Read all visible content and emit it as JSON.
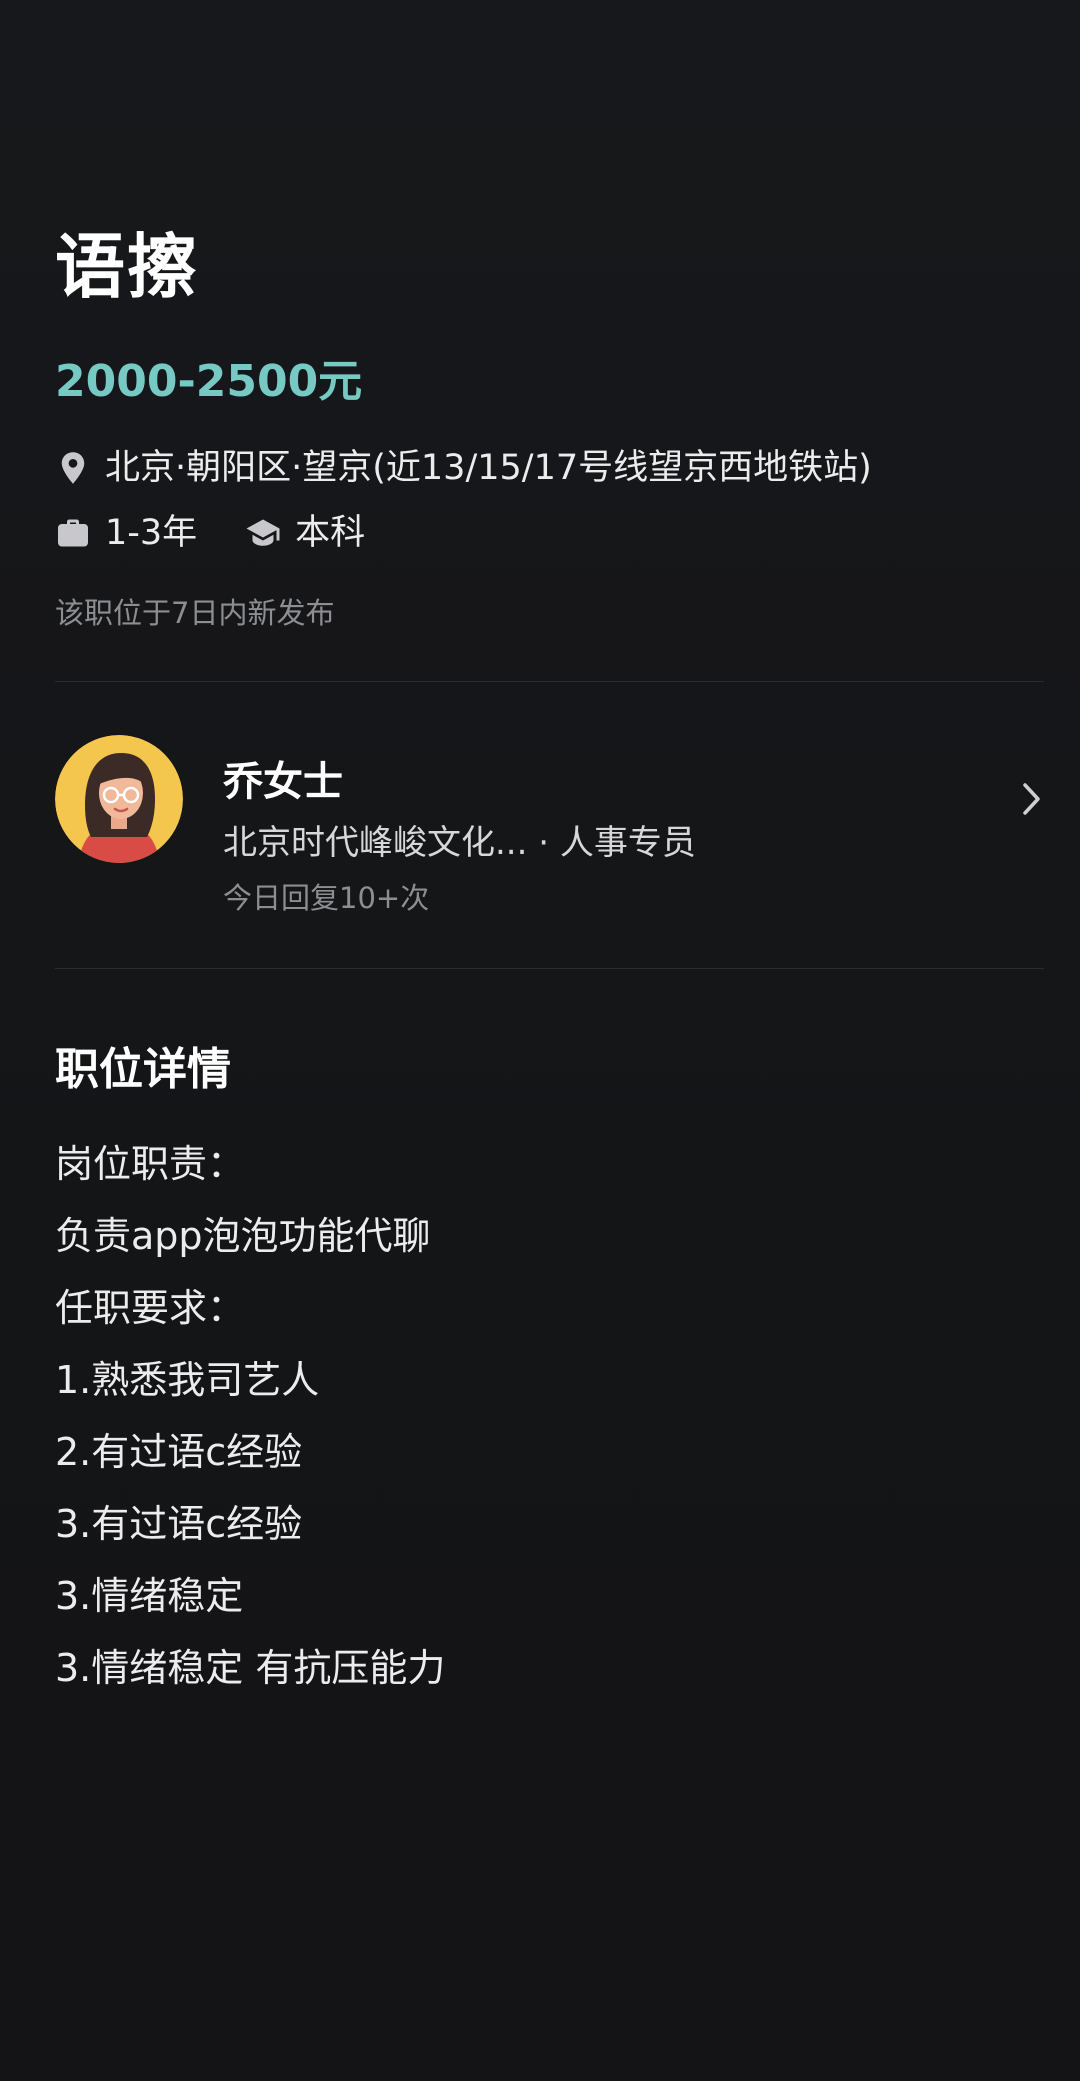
{
  "job": {
    "title": "语擦",
    "salary": "2000-2500元",
    "location": "北京·朝阳区·望京(近13/15/17号线望京西地铁站)",
    "experience": "1-3年",
    "education": "本科",
    "posted_note": "该职位于7日内新发布"
  },
  "recruiter": {
    "name": "乔女士",
    "company_role": "北京时代峰峻文化... · 人事专员",
    "reply_note": "今日回复10+次"
  },
  "details": {
    "section_title": "职位详情",
    "lines": [
      "岗位职责：",
      "负责app泡泡功能代聊",
      "任职要求：",
      "1.熟悉我司艺人",
      "2.有过语c经验",
      "3.有过语c经验",
      "3.情绪稳定",
      "3.情绪稳定 有抗压能力"
    ]
  },
  "colors": {
    "background": "#141517",
    "salary_accent": "#77c9c3",
    "muted_text": "#8d8e92"
  },
  "icons": {
    "location": "location-pin-icon",
    "experience": "briefcase-icon",
    "education": "graduation-cap-icon",
    "navigate": "chevron-right-icon"
  }
}
